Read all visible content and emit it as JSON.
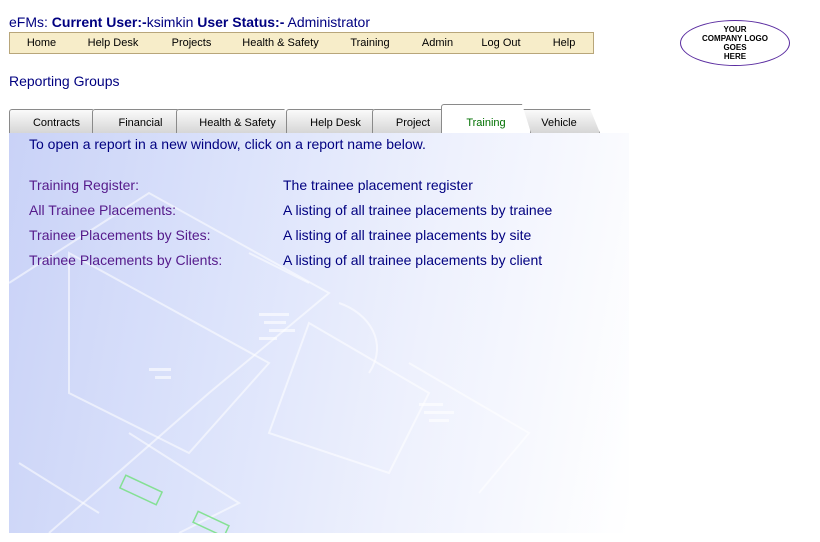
{
  "header": {
    "app": "eFMs:",
    "user_label": "Current User:-",
    "user": "ksimkin",
    "status_label": "User Status:-",
    "status": "Administrator"
  },
  "nav": [
    "Home",
    "Help Desk",
    "Projects",
    "Health & Safety",
    "Training",
    "Admin",
    "Log Out",
    "Help"
  ],
  "logo": [
    "YOUR",
    "COMPANY LOGO",
    "GOES",
    "HERE"
  ],
  "section_title": "Reporting Groups",
  "tabs": [
    "Contracts",
    "Financial",
    "Health & Safety",
    "Help Desk",
    "Project",
    "Training",
    "Vehicle"
  ],
  "active_tab": "Training",
  "instruction": "To open a report in a new window, click on a report name below.",
  "reports": [
    {
      "name": "Training Register:",
      "desc": "The trainee placement register"
    },
    {
      "name": "All Trainee Placements:",
      "desc": "A listing of all trainee placements by trainee"
    },
    {
      "name": "Trainee Placements by Sites:",
      "desc": "A listing of all trainee placements by site"
    },
    {
      "name": "Trainee Placements by Clients:",
      "desc": "A listing of all trainee placements by client"
    }
  ],
  "colors": {
    "accent": "#000080",
    "link": "#551a8b",
    "active_tab": "#007000",
    "nav_bg": "#f7edc9"
  }
}
